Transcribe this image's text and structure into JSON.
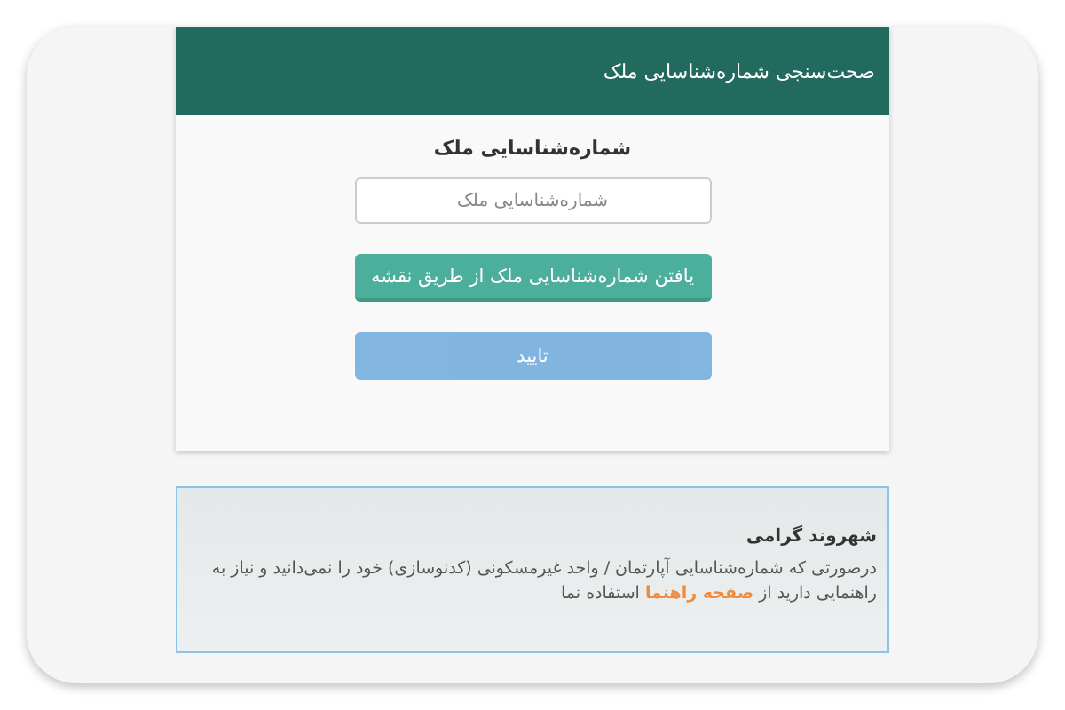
{
  "header": {
    "title": "صحت‌سنجی شماره‌شناسایی ملک"
  },
  "form": {
    "heading": "شماره‌شناسایی ملک",
    "input": {
      "placeholder": "شماره‌شناسایی ملک"
    },
    "buttons": [
      {
        "kind": "map",
        "label": "یافتن شماره‌شناسایی ملک از طریق نقشه",
        "disabled": false
      },
      {
        "kind": "submit",
        "label": "تایید",
        "disabled": true
      }
    ]
  },
  "notice": {
    "title": "شهروند گرامی",
    "text_before": "درصورتی که شماره‌شناسایی آپارتمان / واحد غیرمسکونی (کدنوسازی) خود را نمی‌دانید و نیاز به راهنمایی دارید از",
    "link": "صفحه راهنما",
    "text_after": "استفاده نما"
  }
}
